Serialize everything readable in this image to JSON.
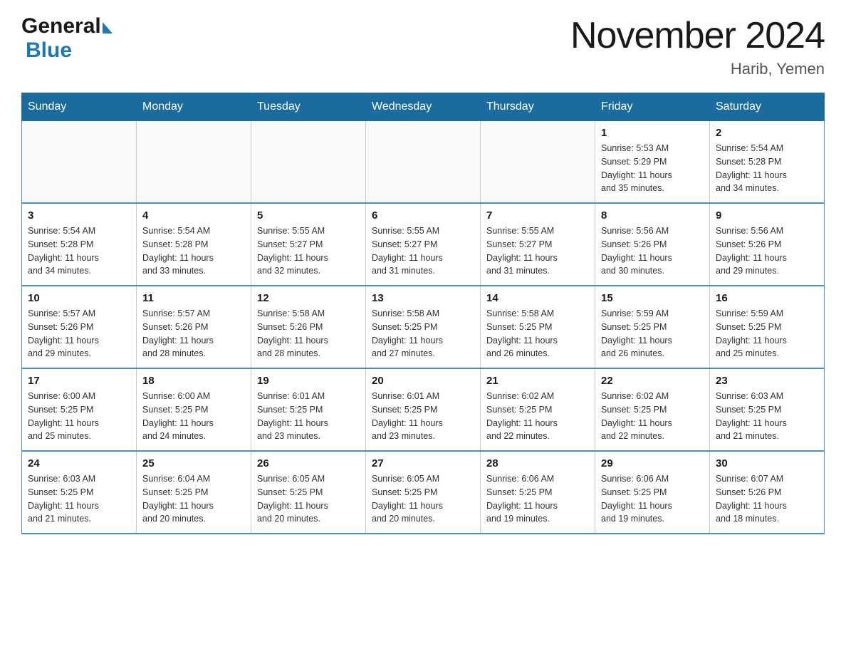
{
  "header": {
    "logo_general": "General",
    "logo_blue": "Blue",
    "title": "November 2024",
    "subtitle": "Harib, Yemen"
  },
  "weekdays": [
    "Sunday",
    "Monday",
    "Tuesday",
    "Wednesday",
    "Thursday",
    "Friday",
    "Saturday"
  ],
  "weeks": [
    {
      "days": [
        {
          "num": "",
          "info": ""
        },
        {
          "num": "",
          "info": ""
        },
        {
          "num": "",
          "info": ""
        },
        {
          "num": "",
          "info": ""
        },
        {
          "num": "",
          "info": ""
        },
        {
          "num": "1",
          "info": "Sunrise: 5:53 AM\nSunset: 5:29 PM\nDaylight: 11 hours\nand 35 minutes."
        },
        {
          "num": "2",
          "info": "Sunrise: 5:54 AM\nSunset: 5:28 PM\nDaylight: 11 hours\nand 34 minutes."
        }
      ]
    },
    {
      "days": [
        {
          "num": "3",
          "info": "Sunrise: 5:54 AM\nSunset: 5:28 PM\nDaylight: 11 hours\nand 34 minutes."
        },
        {
          "num": "4",
          "info": "Sunrise: 5:54 AM\nSunset: 5:28 PM\nDaylight: 11 hours\nand 33 minutes."
        },
        {
          "num": "5",
          "info": "Sunrise: 5:55 AM\nSunset: 5:27 PM\nDaylight: 11 hours\nand 32 minutes."
        },
        {
          "num": "6",
          "info": "Sunrise: 5:55 AM\nSunset: 5:27 PM\nDaylight: 11 hours\nand 31 minutes."
        },
        {
          "num": "7",
          "info": "Sunrise: 5:55 AM\nSunset: 5:27 PM\nDaylight: 11 hours\nand 31 minutes."
        },
        {
          "num": "8",
          "info": "Sunrise: 5:56 AM\nSunset: 5:26 PM\nDaylight: 11 hours\nand 30 minutes."
        },
        {
          "num": "9",
          "info": "Sunrise: 5:56 AM\nSunset: 5:26 PM\nDaylight: 11 hours\nand 29 minutes."
        }
      ]
    },
    {
      "days": [
        {
          "num": "10",
          "info": "Sunrise: 5:57 AM\nSunset: 5:26 PM\nDaylight: 11 hours\nand 29 minutes."
        },
        {
          "num": "11",
          "info": "Sunrise: 5:57 AM\nSunset: 5:26 PM\nDaylight: 11 hours\nand 28 minutes."
        },
        {
          "num": "12",
          "info": "Sunrise: 5:58 AM\nSunset: 5:26 PM\nDaylight: 11 hours\nand 28 minutes."
        },
        {
          "num": "13",
          "info": "Sunrise: 5:58 AM\nSunset: 5:25 PM\nDaylight: 11 hours\nand 27 minutes."
        },
        {
          "num": "14",
          "info": "Sunrise: 5:58 AM\nSunset: 5:25 PM\nDaylight: 11 hours\nand 26 minutes."
        },
        {
          "num": "15",
          "info": "Sunrise: 5:59 AM\nSunset: 5:25 PM\nDaylight: 11 hours\nand 26 minutes."
        },
        {
          "num": "16",
          "info": "Sunrise: 5:59 AM\nSunset: 5:25 PM\nDaylight: 11 hours\nand 25 minutes."
        }
      ]
    },
    {
      "days": [
        {
          "num": "17",
          "info": "Sunrise: 6:00 AM\nSunset: 5:25 PM\nDaylight: 11 hours\nand 25 minutes."
        },
        {
          "num": "18",
          "info": "Sunrise: 6:00 AM\nSunset: 5:25 PM\nDaylight: 11 hours\nand 24 minutes."
        },
        {
          "num": "19",
          "info": "Sunrise: 6:01 AM\nSunset: 5:25 PM\nDaylight: 11 hours\nand 23 minutes."
        },
        {
          "num": "20",
          "info": "Sunrise: 6:01 AM\nSunset: 5:25 PM\nDaylight: 11 hours\nand 23 minutes."
        },
        {
          "num": "21",
          "info": "Sunrise: 6:02 AM\nSunset: 5:25 PM\nDaylight: 11 hours\nand 22 minutes."
        },
        {
          "num": "22",
          "info": "Sunrise: 6:02 AM\nSunset: 5:25 PM\nDaylight: 11 hours\nand 22 minutes."
        },
        {
          "num": "23",
          "info": "Sunrise: 6:03 AM\nSunset: 5:25 PM\nDaylight: 11 hours\nand 21 minutes."
        }
      ]
    },
    {
      "days": [
        {
          "num": "24",
          "info": "Sunrise: 6:03 AM\nSunset: 5:25 PM\nDaylight: 11 hours\nand 21 minutes."
        },
        {
          "num": "25",
          "info": "Sunrise: 6:04 AM\nSunset: 5:25 PM\nDaylight: 11 hours\nand 20 minutes."
        },
        {
          "num": "26",
          "info": "Sunrise: 6:05 AM\nSunset: 5:25 PM\nDaylight: 11 hours\nand 20 minutes."
        },
        {
          "num": "27",
          "info": "Sunrise: 6:05 AM\nSunset: 5:25 PM\nDaylight: 11 hours\nand 20 minutes."
        },
        {
          "num": "28",
          "info": "Sunrise: 6:06 AM\nSunset: 5:25 PM\nDaylight: 11 hours\nand 19 minutes."
        },
        {
          "num": "29",
          "info": "Sunrise: 6:06 AM\nSunset: 5:25 PM\nDaylight: 11 hours\nand 19 minutes."
        },
        {
          "num": "30",
          "info": "Sunrise: 6:07 AM\nSunset: 5:26 PM\nDaylight: 11 hours\nand 18 minutes."
        }
      ]
    }
  ]
}
